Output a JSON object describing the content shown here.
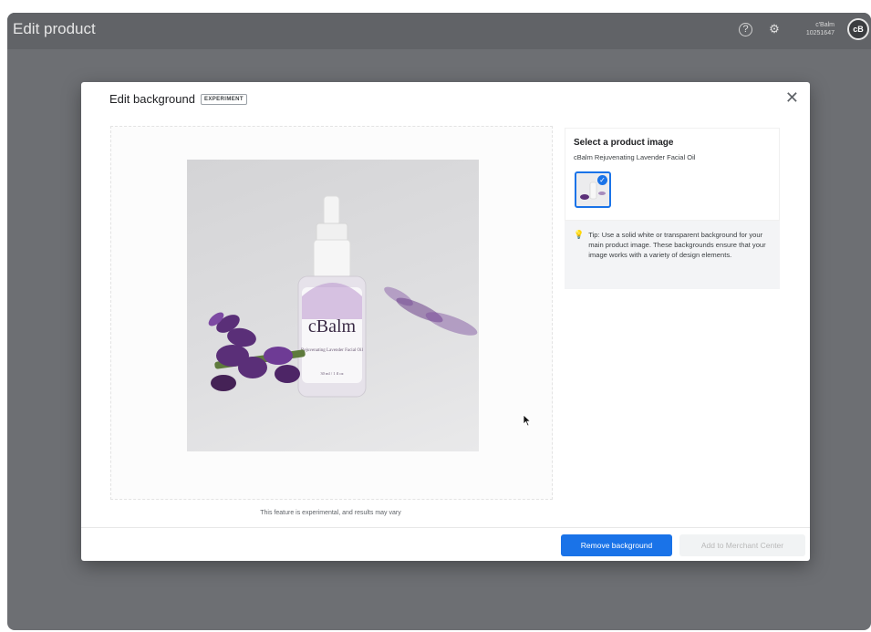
{
  "app": {
    "title": "Edit product"
  },
  "header": {
    "help_icon": "?",
    "settings_icon": "⚙",
    "account_name": "c'Balm",
    "account_id": "10251647",
    "avatar_text": "cB"
  },
  "modal": {
    "title": "Edit background",
    "badge": "EXPERIMENT",
    "close_icon": "✕",
    "disclaimer": "This feature is experimental, and results may vary",
    "product_brand": "cBalm",
    "product_label": "Rejuvenating Lavender Facial Oil",
    "product_volume": "30 ml / 1 fl oz"
  },
  "panel": {
    "select_title": "Select a product image",
    "product_name": "cBalm Rejuvenating Lavender Facial Oil",
    "check_icon": "✓",
    "tip_icon": "💡",
    "tip_text": "Tip: Use a solid white or transparent background for your main product image. These backgrounds ensure that your image works with a variety of design elements."
  },
  "footer": {
    "remove_label": "Remove background",
    "merchant_label": "Add to Merchant Center"
  },
  "colors": {
    "accent": "#1a73e8",
    "backdrop": "#6d6f73"
  }
}
